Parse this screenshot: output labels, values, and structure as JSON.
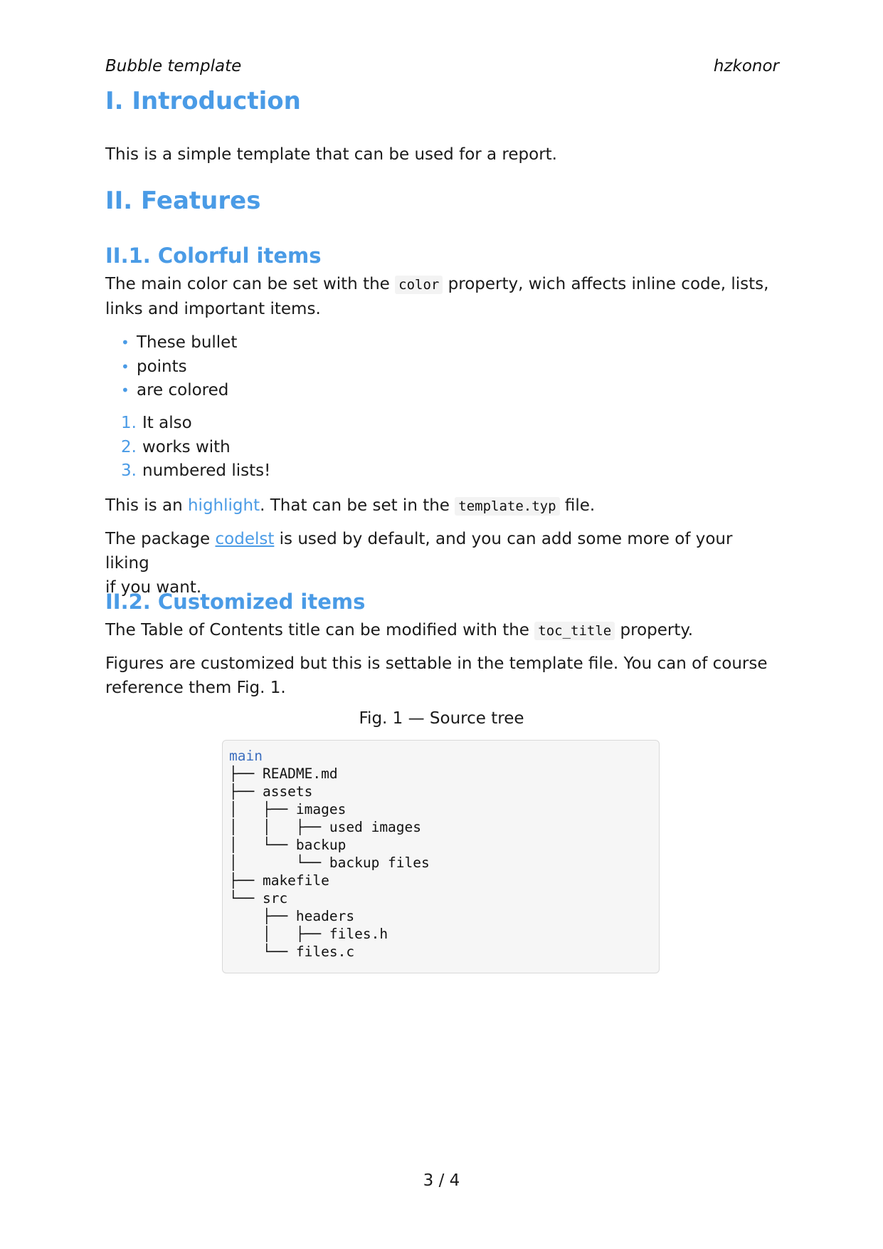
{
  "header": {
    "left": "Bubble template",
    "right": "hzkonor"
  },
  "sections": {
    "intro_title": "I. Introduction",
    "intro_text": "This is a simple template that can be used for a report.",
    "features_title": "II. Features",
    "colorful_title": "II.1. Colorful items",
    "colorful_text_a": "The main color can be set with the",
    "colorful_code": "color",
    "colorful_text_b": "property, wich affects inline code, lists,",
    "colorful_text_c": "links and important items.",
    "bullets": [
      "These bullet",
      "points",
      "are colored"
    ],
    "bullet_marker": "•",
    "numbered": [
      {
        "n": "1.",
        "text": "It also"
      },
      {
        "n": "2.",
        "text": "works with"
      },
      {
        "n": "3.",
        "text": "numbered lists!"
      }
    ],
    "highlight_text_a": "This is an",
    "highlight_word": "highlight",
    "highlight_text_b": ". That can be set in the",
    "highlight_code": "template.typ",
    "highlight_text_c": "file.",
    "package_text_a": "The package",
    "package_link": "codelst",
    "package_text_b": "is used by default, and you can add some more of your liking",
    "package_text_c": "if you want.",
    "custom_title": "II.2. Customized items",
    "toc_text_a": "The Table of Contents title can be modified with the",
    "toc_code": "toc_title",
    "toc_text_b": "property.",
    "fig_text_a": "Figures are customized but this is settable in the template file. You can of course",
    "fig_text_b": "reference them Fig. 1."
  },
  "figure": {
    "caption": "Fig. 1 — Source tree",
    "lines": [
      "main",
      "├── README.md",
      "├── assets",
      "│   ├── images",
      "│   │   ├── used images",
      "│   └── backup",
      "│       └── backup files",
      "├── makefile",
      "└── src",
      "    ├── headers",
      "    │   ├── files.h",
      "    └── files.c"
    ]
  },
  "footer": {
    "page": "3 / 4"
  },
  "colors": {
    "accent": "#4a9be6",
    "code_bg": "#f3f3f3",
    "code_root": "#3d6fbf"
  }
}
